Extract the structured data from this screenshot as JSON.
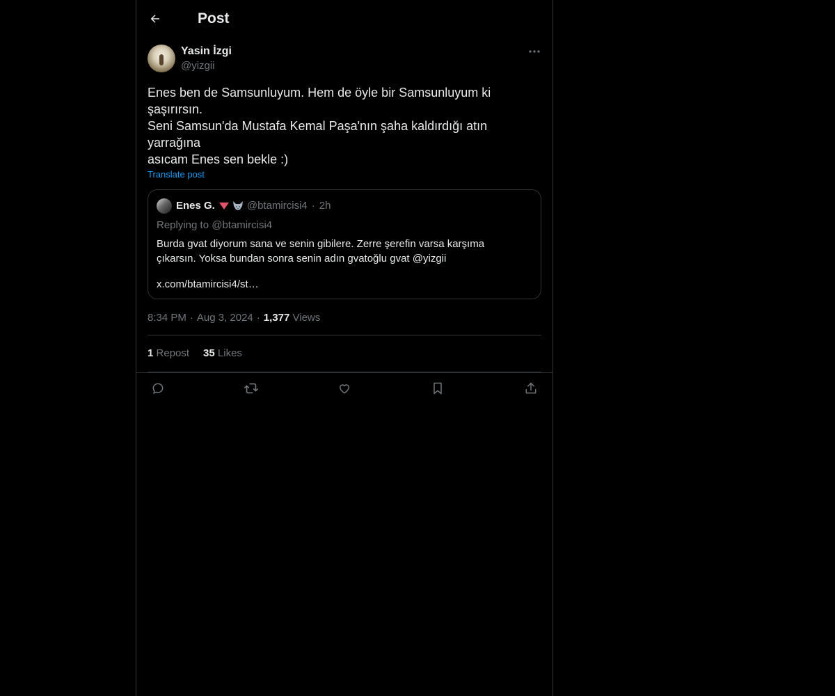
{
  "header": {
    "back_icon": "arrow-left-icon",
    "title": "Post"
  },
  "post": {
    "author_name": "Yasin İzgi",
    "author_handle": "@yizgii",
    "more_icon": "more-horizontal-icon",
    "text": "Enes ben de Samsunluyum. Hem de öyle bir Samsunluyum ki şaşırırsın.\nSeni Samsun'da Mustafa Kemal Paşa'nın şaha kaldırdığı atın yarrağına\nasıcam Enes sen bekle :)",
    "translate_label": "Translate post",
    "quote": {
      "name": "Enes G.",
      "handle": "@btamircisi4",
      "dot": "·",
      "time": "2h",
      "reply_line": "Replying to @btamircisi4",
      "text": "Burda gvat diyorum sana ve senin gibilere. Zerre şerefin varsa karşıma\nçıkarsın. Yoksa bundan sonra senin adın gvatoğlu gvat @yizgii",
      "link": "x.com/btamircisi4/st…"
    },
    "meta": {
      "time": "8:34 PM",
      "sep": "·",
      "date": "Aug 3, 2024",
      "views_count": "1,377",
      "views_label": "Views"
    },
    "stats": {
      "reposts_count": "1",
      "reposts_label": "Repost",
      "likes_count": "35",
      "likes_label": "Likes"
    },
    "actions": [
      "reply-icon",
      "repost-icon",
      "like-icon",
      "bookmark-icon",
      "share-icon"
    ]
  },
  "colors": {
    "background": "#000000",
    "text": "#e7e9ea",
    "secondary": "#71767b",
    "border": "#2f3336",
    "accent": "#1d9bf0"
  }
}
